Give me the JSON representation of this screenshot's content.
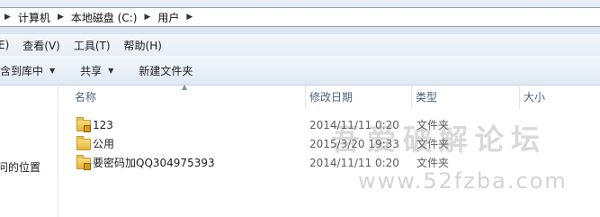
{
  "address": {
    "breadcrumbs": [
      "计算机",
      "本地磁盘 (C:)",
      "用户"
    ]
  },
  "menu": {
    "items": [
      "E)",
      "查看(V)",
      "工具(T)",
      "帮助(H)"
    ]
  },
  "toolbar": {
    "include_library": "包含到库中",
    "share": "共享",
    "new_folder": "新建文件夹"
  },
  "nav": {
    "item_partial": "问的位置"
  },
  "columns": {
    "name": "名称",
    "date": "修改日期",
    "type": "类型",
    "size": "大小"
  },
  "files": [
    {
      "name": "123",
      "date": "2014/11/11 0:20",
      "type": "文件夹",
      "locked": true
    },
    {
      "name": "公用",
      "date": "2015/3/20 19:33",
      "type": "文件夹",
      "locked": false
    },
    {
      "name": "要密码加QQ304975393",
      "date": "2014/11/11 0:20",
      "type": "文件夹",
      "locked": true
    }
  ],
  "watermark": {
    "line1": "吾爱破解论坛",
    "line2": "www.52fzba.com"
  }
}
